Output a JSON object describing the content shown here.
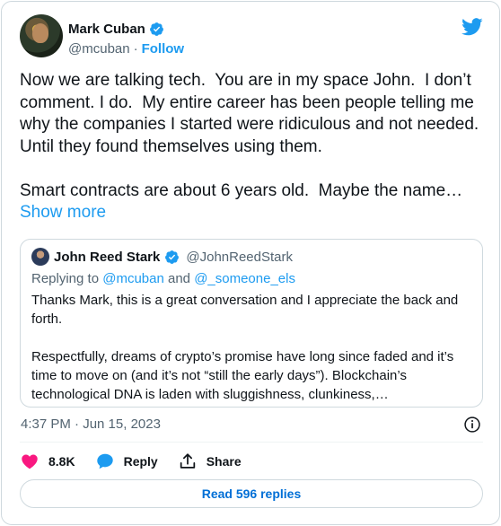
{
  "author": {
    "name": "Mark Cuban",
    "handle": "@mcuban",
    "separator": "·",
    "follow_label": "Follow"
  },
  "tweet": {
    "text": "Now we are talking tech.  You are in my space John.  I don’t comment. I do.  My entire career has been people telling me why the companies I started were ridiculous and not needed.  Until they found themselves using them.\n\nSmart contracts are about 6 years old.  Maybe the name…",
    "show_more": "Show more"
  },
  "quote": {
    "name": "John Reed Stark",
    "handle": "@JohnReedStark",
    "replying_prefix": "Replying to",
    "reply_to_1": "@mcuban",
    "reply_and": "and",
    "reply_to_2": "@_someone_els",
    "body": "Thanks Mark, this is a great conversation and I appreciate the back and forth.\n\nRespectfully, dreams of crypto’s promise have long since faded and it’s time to move on (and it’s not “still the early days”). Blockchain’s technological DNA is laden with sluggishness, clunkiness,…"
  },
  "meta": {
    "timestamp": "4:37 PM · Jun 15, 2023"
  },
  "actions": {
    "likes": "8.8K",
    "reply_label": "Reply",
    "share_label": "Share"
  },
  "read_replies_label": "Read 596 replies",
  "colors": {
    "accent": "#1d9bf0",
    "like": "#f91880",
    "muted": "#536471",
    "border": "#cfd9de"
  },
  "icons": [
    "twitter-bird-icon",
    "verified-badge-icon",
    "info-icon",
    "heart-icon",
    "reply-bubble-icon",
    "share-icon"
  ]
}
